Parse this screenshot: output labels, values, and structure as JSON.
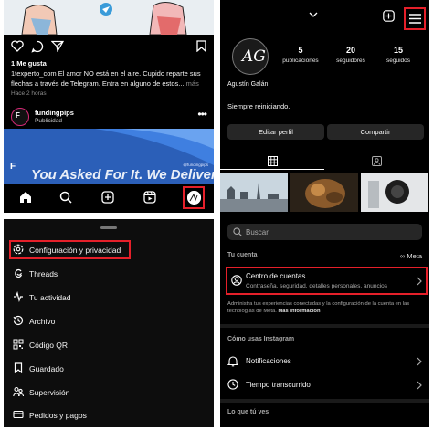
{
  "feed": {
    "likes": "1 Me gusta",
    "caption": "1texperto_com El amor NO está en el aire. Cupido reparte sus flechas a través de Telegram. Entra en alguno de estos...",
    "caption_more": "más",
    "time_ago": "Hace 2 horas",
    "ad": {
      "avatar_letter": "F",
      "name": "fundingpips",
      "sublabel": "Publicidad",
      "banner_text": "You Asked For It. We Delivered.",
      "banner_logo": "F",
      "banner_handle": "@fundingpips"
    },
    "nav_icons": [
      "home-icon",
      "search-icon",
      "create-icon",
      "reels-icon",
      "profile-avatar"
    ]
  },
  "menu": {
    "items": [
      {
        "label": "Configuración y privacidad",
        "icon": "settings-icon"
      },
      {
        "label": "Threads",
        "icon": "threads-icon"
      },
      {
        "label": "Tu actividad",
        "icon": "activity-icon"
      },
      {
        "label": "Archivo",
        "icon": "archive-icon"
      },
      {
        "label": "Código QR",
        "icon": "qr-icon"
      },
      {
        "label": "Guardado",
        "icon": "bookmark-icon"
      },
      {
        "label": "Supervisión",
        "icon": "supervision-icon"
      },
      {
        "label": "Pedidos y pagos",
        "icon": "card-icon"
      }
    ]
  },
  "profile": {
    "stats": [
      {
        "n": "5",
        "label": "publicaciones"
      },
      {
        "n": "20",
        "label": "seguidores"
      },
      {
        "n": "15",
        "label": "seguidos"
      }
    ],
    "avatar_initials": "AG",
    "name": "Agustín Galán",
    "bio": "Siempre reiniciando.",
    "edit_button": "Editar perfil",
    "share_button": "Compartir"
  },
  "settings": {
    "search_placeholder": "Buscar",
    "section_account": "Tu cuenta",
    "meta_label": "∞ Meta",
    "account_center_title": "Centro de cuentas",
    "account_center_sub": "Contraseña, seguridad, detalles personales, anuncios",
    "admin_note": "Administra tus experiencias conectadas y la configuración de la cuenta en las tecnologías de Meta.",
    "admin_more": "Más información",
    "section_usage": "Cómo usas Instagram",
    "rows": [
      {
        "label": "Notificaciones",
        "icon": "bell-icon"
      },
      {
        "label": "Tiempo transcurrido",
        "icon": "clock-icon"
      }
    ],
    "section_see": "Lo que tú ves"
  },
  "colors": {
    "highlight": "#e5202a",
    "background": "#000000",
    "ad_banner": "#2b5fb8"
  }
}
